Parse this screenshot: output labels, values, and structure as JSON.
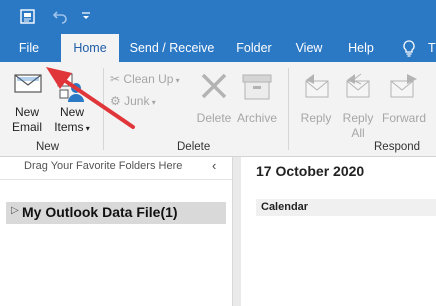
{
  "qat": {
    "icons": [
      "send-receive-icon",
      "undo-icon",
      "customize-qat-icon"
    ]
  },
  "tabs": [
    {
      "label": "File",
      "active": false
    },
    {
      "label": "Home",
      "active": true
    },
    {
      "label": "Send / Receive",
      "active": false
    },
    {
      "label": "Folder",
      "active": false
    },
    {
      "label": "View",
      "active": false
    },
    {
      "label": "Help",
      "active": false
    },
    {
      "label": "T",
      "active": false
    }
  ],
  "tell_me_icon": "lightbulb-icon",
  "ribbon": {
    "new_group": {
      "label": "New",
      "new_email": [
        "New",
        "Email"
      ],
      "new_items": [
        "New",
        "Items"
      ]
    },
    "delete_group": {
      "label": "Delete",
      "clean_up": "Clean Up",
      "junk": "Junk",
      "delete": "Delete",
      "archive": "Archive"
    },
    "respond_group": {
      "label": "Respond",
      "reply": "Reply",
      "reply_all": [
        "Reply",
        "All"
      ],
      "forward": "Forward"
    }
  },
  "folder_pane": {
    "favorites_hint": "Drag Your Favorite Folders Here",
    "collapse_glyph": "‹",
    "data_file": "My Outlook Data File(1)"
  },
  "content": {
    "date": "17 October 2020",
    "calendar_label": "Calendar"
  },
  "colors": {
    "accent": "#2b78c5",
    "ribbon_bg": "#f3f3f3",
    "annotation_arrow": "#e0363a"
  }
}
